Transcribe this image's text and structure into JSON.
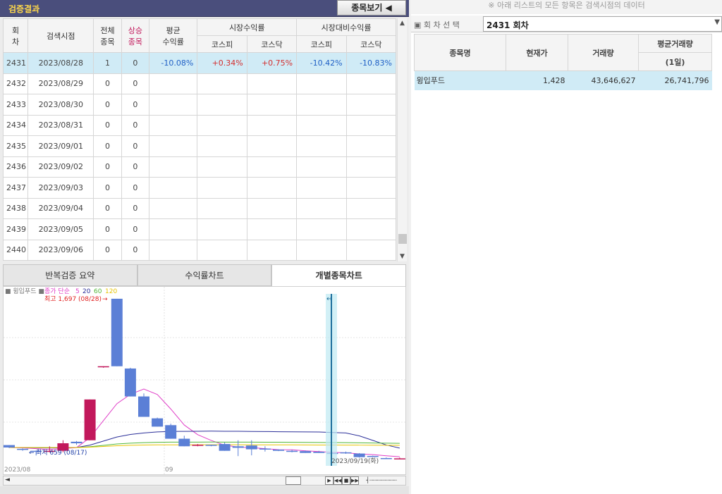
{
  "left_panel": {
    "title": "검증결과",
    "view_button": "종목보기 ◀"
  },
  "table": {
    "headers": {
      "round": "회\n차",
      "search_date": "검색시점",
      "total": "전체\n종목",
      "rising": "상승\n종목",
      "avg_return": "평균\n수익률",
      "market_return": "시장수익률",
      "relative_return": "시장대비수익률",
      "kospi": "코스피",
      "kosdaq": "코스닥"
    },
    "rows": [
      {
        "round": "2431",
        "date": "2023/08/28",
        "total": "1",
        "rising": "0",
        "avg": "-10.08%",
        "m_kospi": "+0.34%",
        "m_kosdaq": "+0.75%",
        "r_kospi": "-10.42%",
        "r_kosdaq": "-10.83%"
      },
      {
        "round": "2432",
        "date": "2023/08/29",
        "total": "0",
        "rising": "0",
        "avg": "",
        "m_kospi": "",
        "m_kosdaq": "",
        "r_kospi": "",
        "r_kosdaq": ""
      },
      {
        "round": "2433",
        "date": "2023/08/30",
        "total": "0",
        "rising": "0",
        "avg": "",
        "m_kospi": "",
        "m_kosdaq": "",
        "r_kospi": "",
        "r_kosdaq": ""
      },
      {
        "round": "2434",
        "date": "2023/08/31",
        "total": "0",
        "rising": "0",
        "avg": "",
        "m_kospi": "",
        "m_kosdaq": "",
        "r_kospi": "",
        "r_kosdaq": ""
      },
      {
        "round": "2435",
        "date": "2023/09/01",
        "total": "0",
        "rising": "0",
        "avg": "",
        "m_kospi": "",
        "m_kosdaq": "",
        "r_kospi": "",
        "r_kosdaq": ""
      },
      {
        "round": "2436",
        "date": "2023/09/02",
        "total": "0",
        "rising": "0",
        "avg": "",
        "m_kospi": "",
        "m_kosdaq": "",
        "r_kospi": "",
        "r_kosdaq": ""
      },
      {
        "round": "2437",
        "date": "2023/09/03",
        "total": "0",
        "rising": "0",
        "avg": "",
        "m_kospi": "",
        "m_kosdaq": "",
        "r_kospi": "",
        "r_kosdaq": ""
      },
      {
        "round": "2438",
        "date": "2023/09/04",
        "total": "0",
        "rising": "0",
        "avg": "",
        "m_kospi": "",
        "m_kosdaq": "",
        "r_kospi": "",
        "r_kosdaq": ""
      },
      {
        "round": "2439",
        "date": "2023/09/05",
        "total": "0",
        "rising": "0",
        "avg": "",
        "m_kospi": "",
        "m_kosdaq": "",
        "r_kospi": "",
        "r_kosdaq": ""
      },
      {
        "round": "2440",
        "date": "2023/09/06",
        "total": "0",
        "rising": "0",
        "avg": "",
        "m_kospi": "",
        "m_kosdaq": "",
        "r_kospi": "",
        "r_kosdaq": ""
      }
    ]
  },
  "tabs": [
    "반복검증 요약",
    "수익률차트",
    "개별종목차트"
  ],
  "active_tab": 2,
  "chart_labels": {
    "stock": "윙입푸드",
    "ma_label": "종가 단순",
    "ma_periods": [
      "5",
      "20",
      "60",
      "120"
    ],
    "high_label": "최고 1,697 (08/28)",
    "low_label": "최저 659 (08/17)",
    "x_left": "2023/08",
    "x_mid": "09",
    "cursor_label": "2023/09/19(화)"
  },
  "chart_data": {
    "type": "candlestick",
    "stock": "윙입푸드",
    "x": [
      "08/15",
      "08/16",
      "08/17",
      "08/18",
      "08/21",
      "08/22",
      "08/23",
      "08/24",
      "08/25",
      "08/28",
      "08/29",
      "08/30",
      "08/31",
      "09/01",
      "09/04",
      "09/05",
      "09/06",
      "09/07",
      "09/08",
      "09/11",
      "09/12",
      "09/13",
      "09/14",
      "09/15",
      "09/18",
      "09/19",
      "09/20",
      "09/21",
      "09/22",
      "09/25"
    ],
    "ohlc": [
      [
        728,
        728,
        708,
        712
      ],
      [
        703,
        706,
        690,
        700
      ],
      [
        690,
        692,
        659,
        685
      ],
      [
        685,
        720,
        680,
        690
      ],
      [
        690,
        760,
        680,
        740
      ],
      [
        750,
        755,
        730,
        740
      ],
      [
        760,
        1030,
        760,
        1030
      ],
      [
        1250,
        1250,
        1240,
        1250
      ],
      [
        1697,
        1697,
        1250,
        1250
      ],
      [
        1235,
        1240,
        1050,
        1050
      ],
      [
        1050,
        1070,
        915,
        915
      ],
      [
        905,
        910,
        850,
        850
      ],
      [
        860,
        870,
        770,
        770
      ],
      [
        770,
        790,
        720,
        720
      ],
      [
        730,
        735,
        720,
        730
      ],
      [
        730,
        730,
        720,
        725
      ],
      [
        735,
        745,
        690,
        690
      ],
      [
        720,
        760,
        655,
        710
      ],
      [
        725,
        760,
        660,
        700
      ],
      [
        705,
        720,
        685,
        698
      ],
      [
        698,
        700,
        688,
        690
      ],
      [
        690,
        697,
        680,
        686
      ],
      [
        688,
        692,
        676,
        676
      ],
      [
        684,
        690,
        676,
        676
      ],
      [
        676,
        680,
        670,
        672
      ],
      [
        680,
        685,
        670,
        676
      ],
      [
        672,
        675,
        645,
        648
      ],
      [
        656,
        658,
        650,
        652
      ],
      [
        642,
        646,
        636,
        638
      ],
      [
        640,
        645,
        635,
        640
      ]
    ],
    "ma_periods": [
      5,
      20,
      60,
      120
    ],
    "ma_colors": [
      "#e040c8",
      "#2b2f99",
      "#52b83a",
      "#e8c400"
    ],
    "annotations": [
      "최고 1,697 (08/28)",
      "최저 659 (08/17)",
      "2023/09/19(화)"
    ],
    "colors": {
      "up": "#c2185b",
      "down": "#5b7fd6",
      "cursor": "#1f6f9c"
    }
  },
  "right_panel": {
    "note": "※ 아래 리스트의 모든 항목은 검색시점의 데이터",
    "round_select_label": "▣ 회 차 선 택",
    "round_select_value": "2431 회차",
    "headers": {
      "name": "종목명",
      "price": "현재가",
      "volume": "거래량",
      "avg_volume": "평균거래량",
      "avg_volume_sub": "(1일)"
    },
    "rows": [
      {
        "name": "윙입푸드",
        "price": "1,428",
        "volume": "43,646,627",
        "avg_volume": "26,741,796"
      }
    ]
  }
}
